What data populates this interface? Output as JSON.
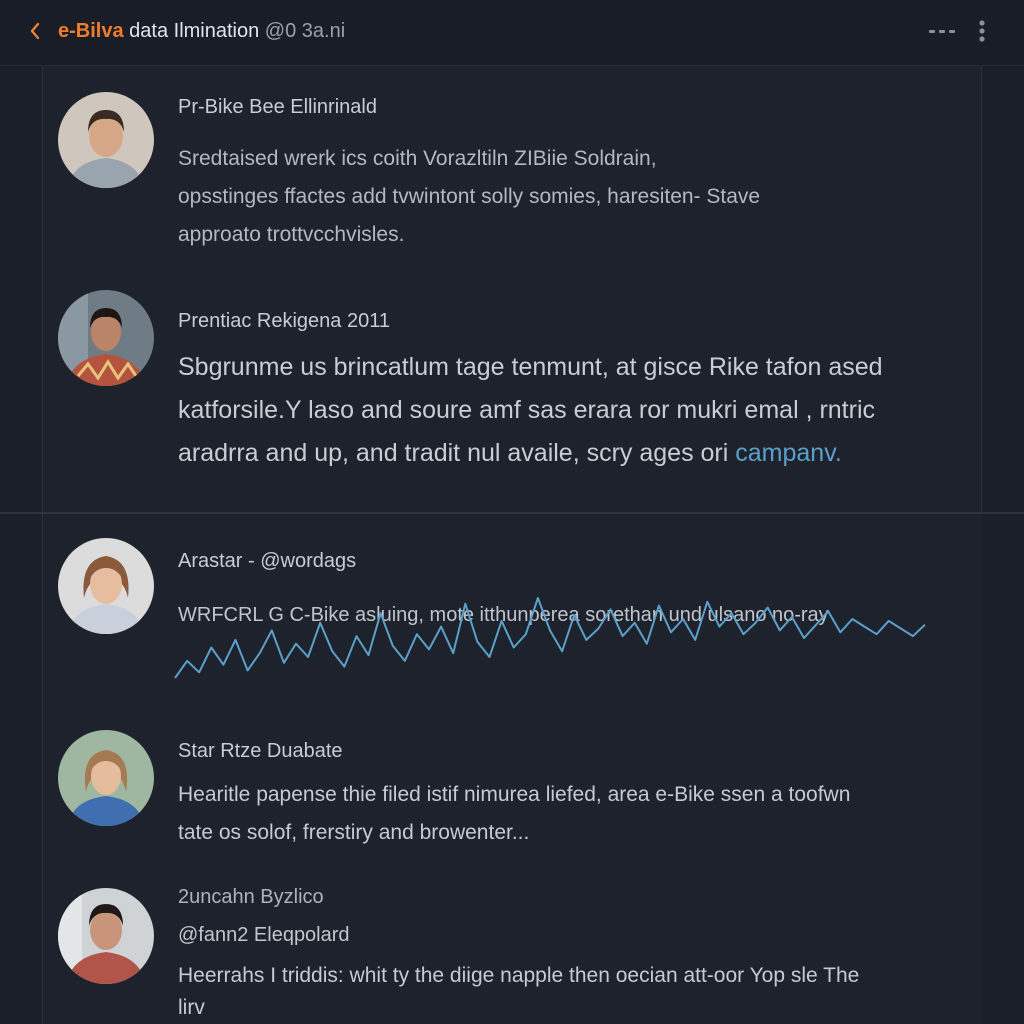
{
  "header": {
    "brand": "e-Bilva",
    "title": " data Ilmination",
    "handle": " @0 3a.ni"
  },
  "posts": [
    {
      "author": "Pr-Bike Bee Ellinrinald",
      "body": "Sredtaised wrerk ics coith Vorazltiln ZIBiie Soldrain,\nopsstinges ffactes add tvwintont solly somies, haresiten- Stave\napproato trottvcchvisles."
    },
    {
      "author": "Prentiac Rekigena 2011",
      "body": "Sbgrunme us brincatlum tage tenmunt, at gisce Rike tafon ased\nkatforsile.Y laso and soure amf sas erara ror mukri emal , rntric\naradrra and up, and tradit nul availe, scry ages ori ",
      "accent": "campanv."
    },
    {
      "author": "Arastar - @wordags",
      "body": "WRFCRL G C-Bike asluing, mote itthunperea sorethan und ulsano no-ray",
      "sparkline": [
        12,
        30,
        18,
        44,
        26,
        52,
        20,
        38,
        62,
        28,
        48,
        34,
        70,
        40,
        24,
        56,
        36,
        80,
        46,
        30,
        58,
        42,
        66,
        38,
        90,
        50,
        34,
        72,
        44,
        58,
        96,
        62,
        40,
        78,
        52,
        64,
        84,
        56,
        70,
        48,
        88,
        60,
        74,
        52,
        92,
        66,
        80,
        58,
        70,
        86,
        62,
        76,
        54,
        68,
        82,
        60,
        74,
        66,
        58,
        72,
        64,
        56,
        68
      ]
    },
    {
      "author": "Star Rtze Duabate",
      "body": "Hearitle papense thie filed istif nimurea liefed, area e-Bike ssen a toofwn\ntate os solof, frerstiry and browenter..."
    },
    {
      "author": "2uncahn Byzlico",
      "handle": "@fann2 Eleqpolard",
      "body": "Heerrahs I triddis: whit ty the diige napple then oecian att-oor Yop sle The\nlirv"
    }
  ],
  "colors": {
    "background": "#1a1f2a",
    "brand": "#f07d2c",
    "accent": "#5aa0c8"
  },
  "icons": [
    "chevron-left-icon",
    "more-horizontal-icon",
    "more-vertical-icon"
  ]
}
